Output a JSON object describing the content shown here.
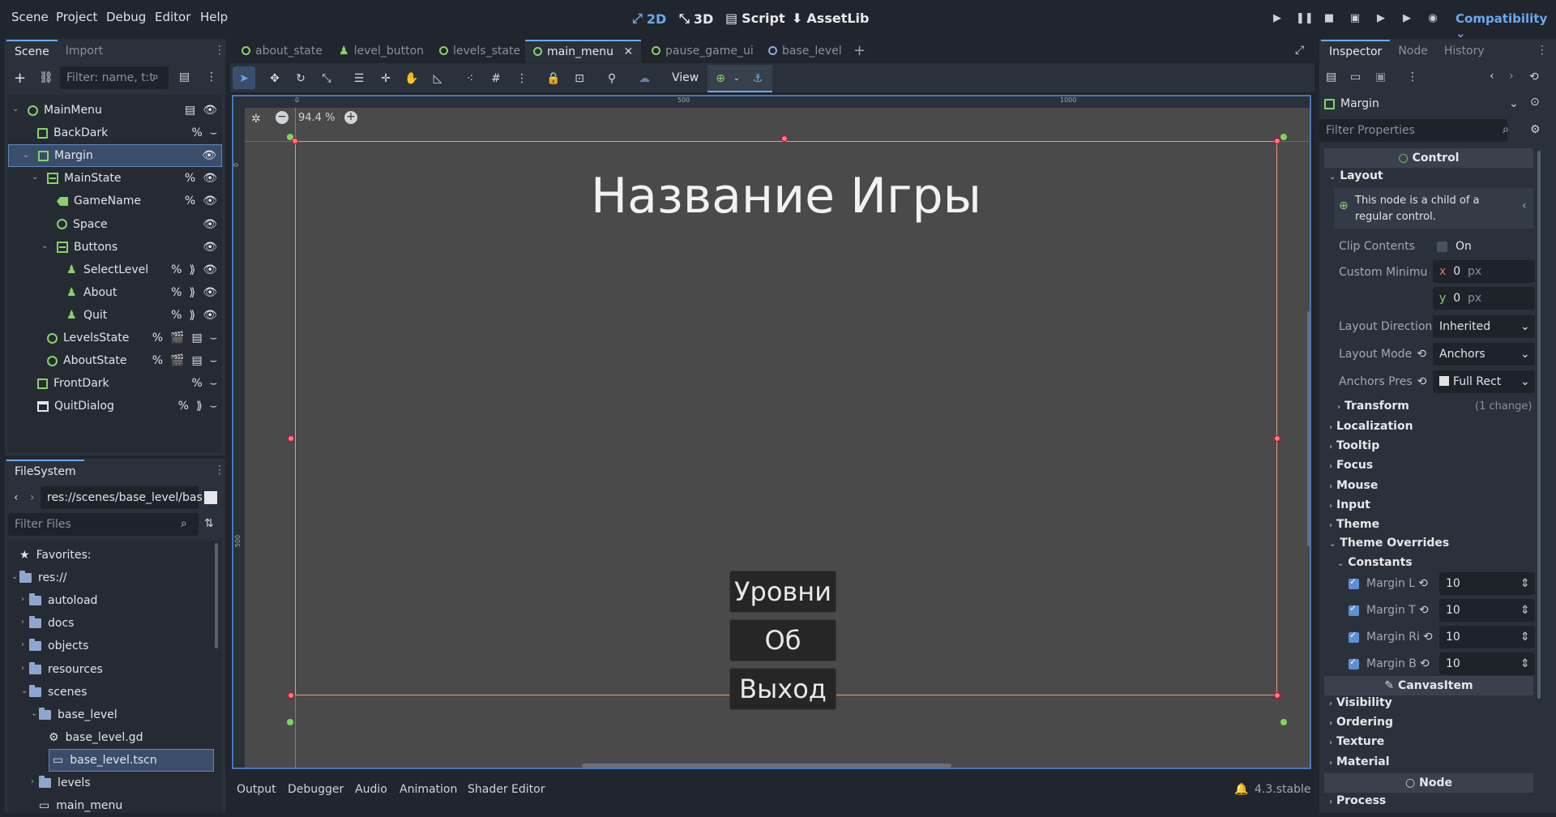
{
  "menu": [
    "Scene",
    "Project",
    "Debug",
    "Editor",
    "Help"
  ],
  "workspaces": {
    "w2d": "2D",
    "w3d": "3D",
    "script": "Script",
    "assetlib": "AssetLib"
  },
  "renderer": "Compatibility",
  "scene_dock": {
    "tabs": [
      "Scene",
      "Import"
    ],
    "filter_placeholder": "Filter: name, t:t",
    "nodes": [
      {
        "name": "MainMenu",
        "type": "ctrl"
      },
      {
        "name": "BackDark",
        "type": "rect"
      },
      {
        "name": "Margin",
        "type": "rect"
      },
      {
        "name": "MainState",
        "type": "box"
      },
      {
        "name": "GameName",
        "type": "label"
      },
      {
        "name": "Space",
        "type": "ctrl"
      },
      {
        "name": "Buttons",
        "type": "box"
      },
      {
        "name": "SelectLevel",
        "type": "btn"
      },
      {
        "name": "About",
        "type": "btn"
      },
      {
        "name": "Quit",
        "type": "btn"
      },
      {
        "name": "LevelsState",
        "type": "ctrl"
      },
      {
        "name": "AboutState",
        "type": "ctrl"
      },
      {
        "name": "FrontDark",
        "type": "rect"
      },
      {
        "name": "QuitDialog",
        "type": "win"
      }
    ]
  },
  "filesystem": {
    "tab": "FileSystem",
    "path": "res://scenes/base_level/bas",
    "filter_placeholder": "Filter Files",
    "items": [
      "Favorites:",
      "res://",
      "autoload",
      "docs",
      "objects",
      "resources",
      "scenes",
      "base_level",
      "base_level.gd",
      "base_level.tscn",
      "levels",
      "main_menu"
    ]
  },
  "editor_tabs": [
    "about_state",
    "level_button",
    "levels_state",
    "main_menu",
    "pause_game_ui",
    "base_level"
  ],
  "toolbar": {
    "view": "View"
  },
  "viewport": {
    "zoom": "94.4 %",
    "ruler": [
      "0",
      "500",
      "1000"
    ],
    "vruler": [
      "0",
      "500"
    ],
    "title": "Название Игры",
    "buttons": [
      "Уровни",
      "Об Игре",
      "Выход"
    ]
  },
  "bottom": {
    "tabs": [
      "Output",
      "Debugger",
      "Audio",
      "Animation",
      "Shader Editor"
    ],
    "version": "4.3.stable"
  },
  "inspector": {
    "tabs": [
      "Inspector",
      "Node",
      "History"
    ],
    "node": "Margin",
    "filter_placeholder": "Filter Properties",
    "control": "Control",
    "layout": "Layout",
    "info": "This node is a child of a regular control.",
    "clip_contents": "Clip Contents",
    "clip_on": "On",
    "custom_min": "Custom Minimu",
    "x_label": "x",
    "y_label": "y",
    "x_val": "0",
    "y_val": "0",
    "px": "px",
    "layout_direction": "Layout Direction",
    "layout_direction_val": "Inherited",
    "layout_mode": "Layout Mode",
    "layout_mode_val": "Anchors",
    "anchors_preset": "Anchors Pres",
    "anchors_preset_val": "Full Rect",
    "transform": "Transform",
    "transform_change": "(1 change)",
    "sections": [
      "Localization",
      "Tooltip",
      "Focus",
      "Mouse",
      "Input",
      "Theme"
    ],
    "theme_overrides": "Theme Overrides",
    "constants": "Constants",
    "margins": [
      {
        "label": "Margin L",
        "val": "10"
      },
      {
        "label": "Margin T",
        "val": "10"
      },
      {
        "label": "Margin Ri",
        "val": "10"
      },
      {
        "label": "Margin B",
        "val": "10"
      }
    ],
    "canvasitem": "CanvasItem",
    "canvas_sections": [
      "Visibility",
      "Ordering",
      "Texture",
      "Material"
    ],
    "node_hdr": "Node",
    "process": "Process"
  }
}
